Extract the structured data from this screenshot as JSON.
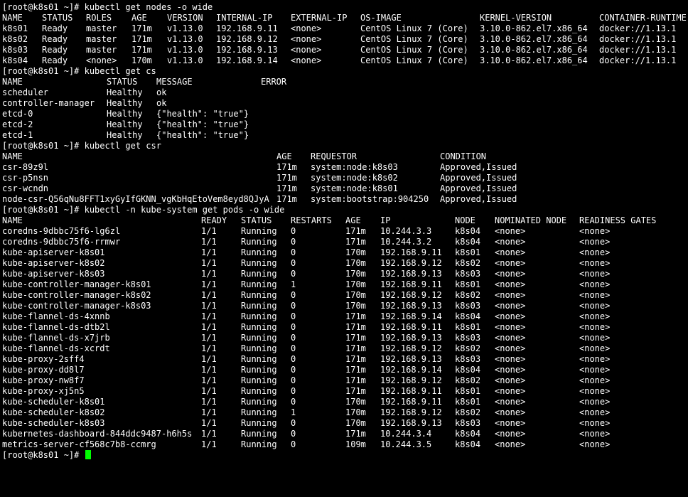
{
  "prompt": "[root@k8s01 ~]#",
  "cursor_color": "#00ff00",
  "blocks": [
    {
      "command": "kubectl get nodes -o wide",
      "table": {
        "header": [
          "NAME",
          "STATUS",
          "ROLES",
          "AGE",
          "VERSION",
          "INTERNAL-IP",
          "EXTERNAL-IP",
          "OS-IMAGE",
          "KERNEL-VERSION",
          "CONTAINER-RUNTIME"
        ],
        "rows": [
          [
            "k8s01",
            "Ready",
            "master",
            "171m",
            "v1.13.0",
            "192.168.9.11",
            "<none>",
            "CentOS Linux 7 (Core)",
            "3.10.0-862.el7.x86_64",
            "docker://1.13.1"
          ],
          [
            "k8s02",
            "Ready",
            "master",
            "171m",
            "v1.13.0",
            "192.168.9.12",
            "<none>",
            "CentOS Linux 7 (Core)",
            "3.10.0-862.el7.x86_64",
            "docker://1.13.1"
          ],
          [
            "k8s03",
            "Ready",
            "master",
            "171m",
            "v1.13.0",
            "192.168.9.13",
            "<none>",
            "CentOS Linux 7 (Core)",
            "3.10.0-862.el7.x86_64",
            "docker://1.13.1"
          ],
          [
            "k8s04",
            "Ready",
            "<none>",
            "170m",
            "v1.13.0",
            "192.168.9.14",
            "<none>",
            "CentOS Linux 7 (Core)",
            "3.10.0-862.el7.x86_64",
            "docker://1.13.1"
          ]
        ]
      }
    },
    {
      "command": "kubectl get cs",
      "table": {
        "header": [
          "NAME",
          "STATUS",
          "MESSAGE",
          "ERROR"
        ],
        "rows": [
          [
            "scheduler",
            "Healthy",
            "ok",
            ""
          ],
          [
            "controller-manager",
            "Healthy",
            "ok",
            ""
          ],
          [
            "etcd-0",
            "Healthy",
            "{\"health\": \"true\"}",
            ""
          ],
          [
            "etcd-2",
            "Healthy",
            "{\"health\": \"true\"}",
            ""
          ],
          [
            "etcd-1",
            "Healthy",
            "{\"health\": \"true\"}",
            ""
          ]
        ]
      }
    },
    {
      "command": "kubectl get csr",
      "table": {
        "header": [
          "NAME",
          "AGE",
          "REQUESTOR",
          "CONDITION"
        ],
        "rows": [
          [
            "csr-89z9l",
            "171m",
            "system:node:k8s03",
            "Approved,Issued"
          ],
          [
            "csr-p5nsn",
            "171m",
            "system:node:k8s02",
            "Approved,Issued"
          ],
          [
            "csr-wcndn",
            "171m",
            "system:node:k8s01",
            "Approved,Issued"
          ],
          [
            "node-csr-Q56qNu8FFT1xyGyIfGKNN_vgKbHqEtoVem8eyd8QJyA",
            "171m",
            "system:bootstrap:904250",
            "Approved,Issued"
          ]
        ]
      }
    },
    {
      "command": "kubectl -n kube-system get pods -o wide",
      "table": {
        "header": [
          "NAME",
          "READY",
          "STATUS",
          "RESTARTS",
          "AGE",
          "IP",
          "NODE",
          "NOMINATED NODE",
          "READINESS GATES"
        ],
        "rows": [
          [
            "coredns-9dbbc75f6-lg6zl",
            "1/1",
            "Running",
            "0",
            "171m",
            "10.244.3.3",
            "k8s04",
            "<none>",
            "<none>"
          ],
          [
            "coredns-9dbbc75f6-rrmwr",
            "1/1",
            "Running",
            "0",
            "171m",
            "10.244.3.2",
            "k8s04",
            "<none>",
            "<none>"
          ],
          [
            "kube-apiserver-k8s01",
            "1/1",
            "Running",
            "0",
            "170m",
            "192.168.9.11",
            "k8s01",
            "<none>",
            "<none>"
          ],
          [
            "kube-apiserver-k8s02",
            "1/1",
            "Running",
            "0",
            "170m",
            "192.168.9.12",
            "k8s02",
            "<none>",
            "<none>"
          ],
          [
            "kube-apiserver-k8s03",
            "1/1",
            "Running",
            "0",
            "170m",
            "192.168.9.13",
            "k8s03",
            "<none>",
            "<none>"
          ],
          [
            "kube-controller-manager-k8s01",
            "1/1",
            "Running",
            "1",
            "170m",
            "192.168.9.11",
            "k8s01",
            "<none>",
            "<none>"
          ],
          [
            "kube-controller-manager-k8s02",
            "1/1",
            "Running",
            "0",
            "170m",
            "192.168.9.12",
            "k8s02",
            "<none>",
            "<none>"
          ],
          [
            "kube-controller-manager-k8s03",
            "1/1",
            "Running",
            "0",
            "170m",
            "192.168.9.13",
            "k8s03",
            "<none>",
            "<none>"
          ],
          [
            "kube-flannel-ds-4xnnb",
            "1/1",
            "Running",
            "0",
            "171m",
            "192.168.9.14",
            "k8s04",
            "<none>",
            "<none>"
          ],
          [
            "kube-flannel-ds-dtb2l",
            "1/1",
            "Running",
            "0",
            "171m",
            "192.168.9.11",
            "k8s01",
            "<none>",
            "<none>"
          ],
          [
            "kube-flannel-ds-x7jrb",
            "1/1",
            "Running",
            "0",
            "171m",
            "192.168.9.13",
            "k8s03",
            "<none>",
            "<none>"
          ],
          [
            "kube-flannel-ds-xcrdt",
            "1/1",
            "Running",
            "0",
            "171m",
            "192.168.9.12",
            "k8s02",
            "<none>",
            "<none>"
          ],
          [
            "kube-proxy-2sff4",
            "1/1",
            "Running",
            "0",
            "171m",
            "192.168.9.13",
            "k8s03",
            "<none>",
            "<none>"
          ],
          [
            "kube-proxy-dd8l7",
            "1/1",
            "Running",
            "0",
            "171m",
            "192.168.9.14",
            "k8s04",
            "<none>",
            "<none>"
          ],
          [
            "kube-proxy-nw8f7",
            "1/1",
            "Running",
            "0",
            "171m",
            "192.168.9.12",
            "k8s02",
            "<none>",
            "<none>"
          ],
          [
            "kube-proxy-xj5n5",
            "1/1",
            "Running",
            "0",
            "171m",
            "192.168.9.11",
            "k8s01",
            "<none>",
            "<none>"
          ],
          [
            "kube-scheduler-k8s01",
            "1/1",
            "Running",
            "0",
            "170m",
            "192.168.9.11",
            "k8s01",
            "<none>",
            "<none>"
          ],
          [
            "kube-scheduler-k8s02",
            "1/1",
            "Running",
            "1",
            "170m",
            "192.168.9.12",
            "k8s02",
            "<none>",
            "<none>"
          ],
          [
            "kube-scheduler-k8s03",
            "1/1",
            "Running",
            "0",
            "170m",
            "192.168.9.13",
            "k8s03",
            "<none>",
            "<none>"
          ],
          [
            "kubernetes-dashboard-844ddc9487-h6h5s",
            "1/1",
            "Running",
            "0",
            "171m",
            "10.244.3.4",
            "k8s04",
            "<none>",
            "<none>"
          ],
          [
            "metrics-server-cf568c7b8-ccmrg",
            "1/1",
            "Running",
            "0",
            "109m",
            "10.244.3.5",
            "k8s04",
            "<none>",
            "<none>"
          ]
        ]
      }
    }
  ]
}
